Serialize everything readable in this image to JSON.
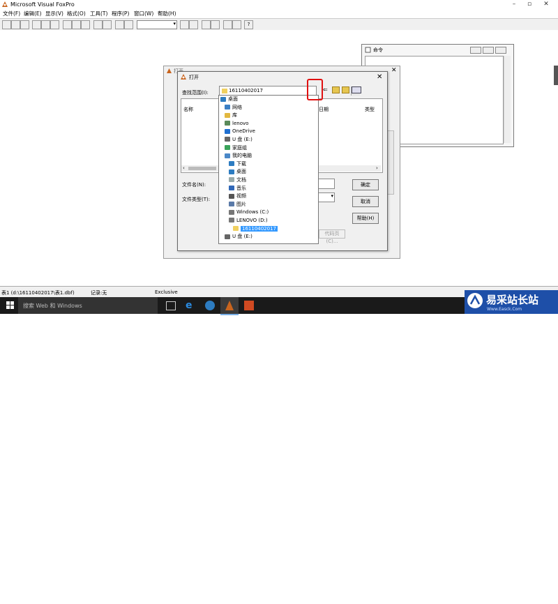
{
  "app": {
    "title": "Microsoft Visual FoxPro"
  },
  "window_controls": {
    "minimize": "–",
    "restore": "▫",
    "close": "✕"
  },
  "menu": [
    "文件(F)",
    "编辑(E)",
    "显示(V)",
    "格式(O)",
    "工具(T)",
    "程序(P)",
    "窗口(W)",
    "帮助(H)"
  ],
  "command_window": {
    "title": "命令"
  },
  "bg_dialog": {
    "title": "打开"
  },
  "open_dialog": {
    "title": "打开",
    "look_in_label": "查找范围(I):",
    "look_in_value": "16110402017",
    "col_name": "名称",
    "col_date": "日期",
    "col_type": "类型",
    "filename_label": "文件名(N):",
    "filetype_label": "文件类型(T):",
    "ok": "确定",
    "cancel": "取消",
    "help": "帮助(H)",
    "code_page": "代码页(C)..."
  },
  "dropdown_items": [
    {
      "label": "桌面",
      "icon": "desktop-icon",
      "indent": 0
    },
    {
      "label": "网络",
      "icon": "network-icon",
      "indent": 1
    },
    {
      "label": "库",
      "icon": "library-icon",
      "indent": 1
    },
    {
      "label": "lenovo",
      "icon": "user-icon",
      "indent": 1
    },
    {
      "label": "OneDrive",
      "icon": "cloud-icon",
      "indent": 1
    },
    {
      "label": "U 盘 (E:)",
      "icon": "usb-drive-icon",
      "indent": 1
    },
    {
      "label": "家庭组",
      "icon": "homegroup-icon",
      "indent": 1
    },
    {
      "label": "我的电脑",
      "icon": "computer-icon",
      "indent": 1
    },
    {
      "label": "下载",
      "icon": "download-icon",
      "indent": 2
    },
    {
      "label": "桌面",
      "icon": "desktop-icon",
      "indent": 2
    },
    {
      "label": "文档",
      "icon": "document-icon",
      "indent": 2
    },
    {
      "label": "音乐",
      "icon": "music-icon",
      "indent": 2
    },
    {
      "label": "视频",
      "icon": "video-icon",
      "indent": 2
    },
    {
      "label": "图片",
      "icon": "picture-icon",
      "indent": 2
    },
    {
      "label": "Windows (C:)",
      "icon": "drive-icon",
      "indent": 2
    },
    {
      "label": "LENOVO (D:)",
      "icon": "drive-icon",
      "indent": 2
    },
    {
      "label": "16110402017",
      "icon": "folder-icon",
      "indent": 3,
      "selected": true
    },
    {
      "label": "U 盘 (E:)",
      "icon": "usb-drive-icon",
      "indent": 1
    }
  ],
  "status": {
    "path": "表1 (d:\\16110402017\\表1.dbf)",
    "records": "记录:无",
    "mode": "Exclusive"
  },
  "taskbar": {
    "search_placeholder": "搜索 Web 和 Windows"
  },
  "watermark": {
    "text": "易采站长站",
    "url": "Www.Easck.Com"
  },
  "colors": {
    "highlight": "#3399ff",
    "annotation": "#e01010",
    "taskbar": "#1a1a1a"
  }
}
